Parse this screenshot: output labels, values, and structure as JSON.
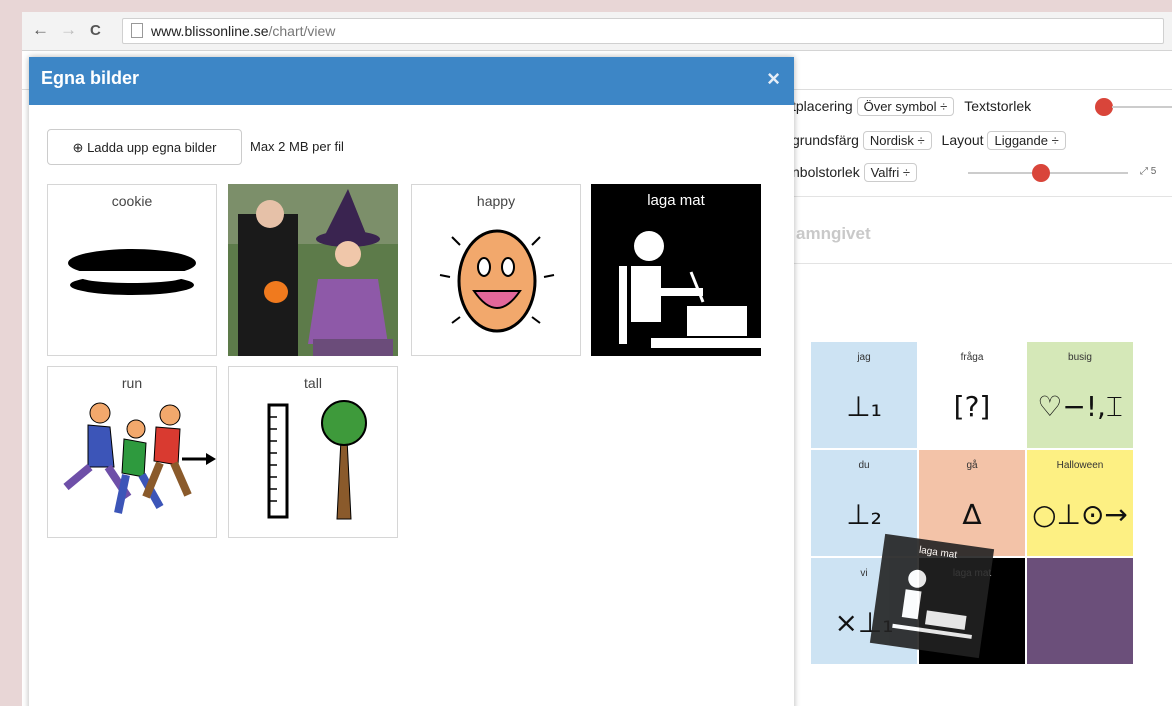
{
  "browser": {
    "url_host": "www.blissonline.se",
    "url_path": "/chart/view",
    "back_glyph": "←",
    "forward_glyph": "→",
    "reload_glyph": "C"
  },
  "toolbar": {
    "row1_label": "tplacering",
    "row1_value": "Över symbol ÷",
    "row1_label2": "Textstorlek",
    "row2_label": "grundsfärg",
    "row2_value": "Nordisk ÷",
    "row2_label2": "Layout",
    "row2_value2": "Liggande ÷",
    "row3_label": "nbolstorlek",
    "row3_value": "Valfri ÷",
    "row3_extra": "5"
  },
  "chart": {
    "title": "amngivet",
    "cells": [
      {
        "label": "jag",
        "symbol": "⊥₁",
        "color": "#cde3f3"
      },
      {
        "label": "fråga",
        "symbol": "[?]",
        "color": "#ffffff"
      },
      {
        "label": "busig",
        "symbol": "♡−!,⌶",
        "color": "#d5e8b8"
      },
      {
        "label": "du",
        "symbol": "⊥₂",
        "color": "#cde3f3"
      },
      {
        "label": "gå",
        "symbol": "∆",
        "color": "#f3c3a8"
      },
      {
        "label": "Halloween",
        "symbol": "○⊥⊙→",
        "color": "#fdf083"
      },
      {
        "label": "vi",
        "symbol": "×⊥₁",
        "color": "#cde3f3"
      },
      {
        "label": "laga mat",
        "symbol": "",
        "color": "#000000"
      },
      {
        "label": "",
        "symbol": "",
        "color": "#6b4f7a"
      }
    ],
    "drag_label": "laga mat"
  },
  "modal": {
    "title": "Egna bilder",
    "close": "×",
    "upload_label": "Ladda upp egna bilder",
    "upload_icon": "⊕",
    "max_text": "Max 2 MB per fil",
    "images": [
      {
        "caption": "cookie"
      },
      {
        "caption": ""
      },
      {
        "caption": "happy"
      },
      {
        "caption": "laga mat"
      },
      {
        "caption": "run"
      },
      {
        "caption": "tall"
      }
    ]
  },
  "colors": {
    "modal_header": "#3d86c6",
    "slider": "#d9453a"
  }
}
